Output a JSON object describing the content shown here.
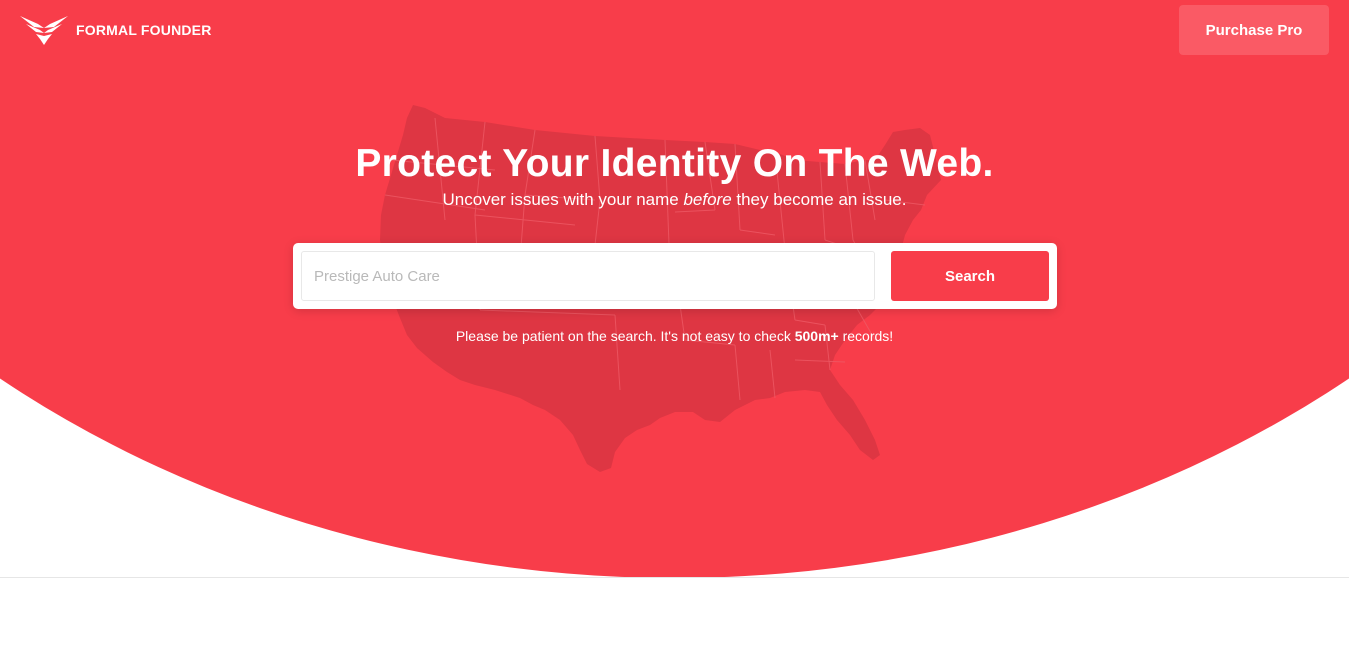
{
  "brand": {
    "name": "FORMAL FOUNDER",
    "logo_icon": "phoenix-wings-logo-icon"
  },
  "header": {
    "purchase_label": "Purchase Pro"
  },
  "hero": {
    "headline": "Protect Your Identity On The Web.",
    "subline_before": "Uncover issues with your name ",
    "subline_em": "before",
    "subline_after": " they become an issue.",
    "background_icon": "usa-map-icon"
  },
  "search": {
    "placeholder": "Prestige Auto Care",
    "value": "",
    "button_label": "Search"
  },
  "note": {
    "text_before": "Please be patient on the search. It's not easy to check ",
    "text_bold": "500m+",
    "text_after": " records!"
  },
  "colors": {
    "accent": "#f83d4a",
    "button_light": "#fa5a65",
    "map_shade": "#de3643",
    "text_on_accent": "#ffffff"
  }
}
